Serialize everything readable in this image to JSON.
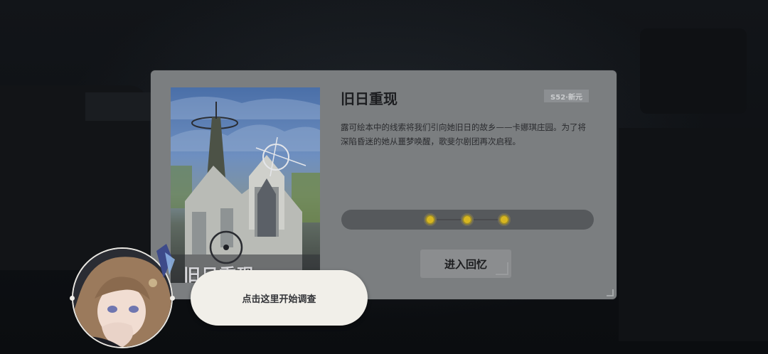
{
  "card": {
    "title": "旧日重现",
    "tag": "S52·新元",
    "description_line1": "露可绘本中的线索将我们引向她旧日的故乡——卡娜琪庄园。为了将",
    "description_line2": "深陷昏迷的她从噩梦唤醒，歌斐尔剧团再次启程。",
    "art_title": "旧日重现",
    "enter_button": "进入回忆",
    "progress": {
      "nodes": 3
    }
  },
  "guide": {
    "bubble_text": "点击这里开始调查"
  },
  "colors": {
    "card_bg": "#7b7e80",
    "node_gold": "#d8b61f",
    "bubble_bg": "#f1efe9"
  }
}
